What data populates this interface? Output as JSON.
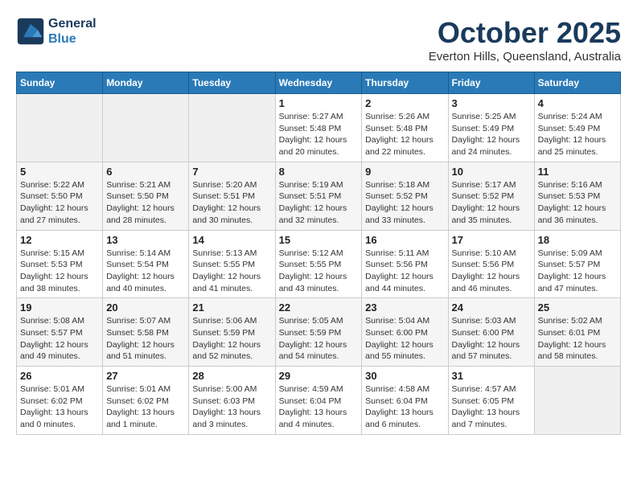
{
  "header": {
    "logo_line1": "General",
    "logo_line2": "Blue",
    "month": "October 2025",
    "location": "Everton Hills, Queensland, Australia"
  },
  "days_of_week": [
    "Sunday",
    "Monday",
    "Tuesday",
    "Wednesday",
    "Thursday",
    "Friday",
    "Saturday"
  ],
  "weeks": [
    [
      {
        "day": "",
        "info": ""
      },
      {
        "day": "",
        "info": ""
      },
      {
        "day": "",
        "info": ""
      },
      {
        "day": "1",
        "info": "Sunrise: 5:27 AM\nSunset: 5:48 PM\nDaylight: 12 hours\nand 20 minutes."
      },
      {
        "day": "2",
        "info": "Sunrise: 5:26 AM\nSunset: 5:48 PM\nDaylight: 12 hours\nand 22 minutes."
      },
      {
        "day": "3",
        "info": "Sunrise: 5:25 AM\nSunset: 5:49 PM\nDaylight: 12 hours\nand 24 minutes."
      },
      {
        "day": "4",
        "info": "Sunrise: 5:24 AM\nSunset: 5:49 PM\nDaylight: 12 hours\nand 25 minutes."
      }
    ],
    [
      {
        "day": "5",
        "info": "Sunrise: 5:22 AM\nSunset: 5:50 PM\nDaylight: 12 hours\nand 27 minutes."
      },
      {
        "day": "6",
        "info": "Sunrise: 5:21 AM\nSunset: 5:50 PM\nDaylight: 12 hours\nand 28 minutes."
      },
      {
        "day": "7",
        "info": "Sunrise: 5:20 AM\nSunset: 5:51 PM\nDaylight: 12 hours\nand 30 minutes."
      },
      {
        "day": "8",
        "info": "Sunrise: 5:19 AM\nSunset: 5:51 PM\nDaylight: 12 hours\nand 32 minutes."
      },
      {
        "day": "9",
        "info": "Sunrise: 5:18 AM\nSunset: 5:52 PM\nDaylight: 12 hours\nand 33 minutes."
      },
      {
        "day": "10",
        "info": "Sunrise: 5:17 AM\nSunset: 5:52 PM\nDaylight: 12 hours\nand 35 minutes."
      },
      {
        "day": "11",
        "info": "Sunrise: 5:16 AM\nSunset: 5:53 PM\nDaylight: 12 hours\nand 36 minutes."
      }
    ],
    [
      {
        "day": "12",
        "info": "Sunrise: 5:15 AM\nSunset: 5:53 PM\nDaylight: 12 hours\nand 38 minutes."
      },
      {
        "day": "13",
        "info": "Sunrise: 5:14 AM\nSunset: 5:54 PM\nDaylight: 12 hours\nand 40 minutes."
      },
      {
        "day": "14",
        "info": "Sunrise: 5:13 AM\nSunset: 5:55 PM\nDaylight: 12 hours\nand 41 minutes."
      },
      {
        "day": "15",
        "info": "Sunrise: 5:12 AM\nSunset: 5:55 PM\nDaylight: 12 hours\nand 43 minutes."
      },
      {
        "day": "16",
        "info": "Sunrise: 5:11 AM\nSunset: 5:56 PM\nDaylight: 12 hours\nand 44 minutes."
      },
      {
        "day": "17",
        "info": "Sunrise: 5:10 AM\nSunset: 5:56 PM\nDaylight: 12 hours\nand 46 minutes."
      },
      {
        "day": "18",
        "info": "Sunrise: 5:09 AM\nSunset: 5:57 PM\nDaylight: 12 hours\nand 47 minutes."
      }
    ],
    [
      {
        "day": "19",
        "info": "Sunrise: 5:08 AM\nSunset: 5:57 PM\nDaylight: 12 hours\nand 49 minutes."
      },
      {
        "day": "20",
        "info": "Sunrise: 5:07 AM\nSunset: 5:58 PM\nDaylight: 12 hours\nand 51 minutes."
      },
      {
        "day": "21",
        "info": "Sunrise: 5:06 AM\nSunset: 5:59 PM\nDaylight: 12 hours\nand 52 minutes."
      },
      {
        "day": "22",
        "info": "Sunrise: 5:05 AM\nSunset: 5:59 PM\nDaylight: 12 hours\nand 54 minutes."
      },
      {
        "day": "23",
        "info": "Sunrise: 5:04 AM\nSunset: 6:00 PM\nDaylight: 12 hours\nand 55 minutes."
      },
      {
        "day": "24",
        "info": "Sunrise: 5:03 AM\nSunset: 6:00 PM\nDaylight: 12 hours\nand 57 minutes."
      },
      {
        "day": "25",
        "info": "Sunrise: 5:02 AM\nSunset: 6:01 PM\nDaylight: 12 hours\nand 58 minutes."
      }
    ],
    [
      {
        "day": "26",
        "info": "Sunrise: 5:01 AM\nSunset: 6:02 PM\nDaylight: 13 hours\nand 0 minutes."
      },
      {
        "day": "27",
        "info": "Sunrise: 5:01 AM\nSunset: 6:02 PM\nDaylight: 13 hours\nand 1 minute."
      },
      {
        "day": "28",
        "info": "Sunrise: 5:00 AM\nSunset: 6:03 PM\nDaylight: 13 hours\nand 3 minutes."
      },
      {
        "day": "29",
        "info": "Sunrise: 4:59 AM\nSunset: 6:04 PM\nDaylight: 13 hours\nand 4 minutes."
      },
      {
        "day": "30",
        "info": "Sunrise: 4:58 AM\nSunset: 6:04 PM\nDaylight: 13 hours\nand 6 minutes."
      },
      {
        "day": "31",
        "info": "Sunrise: 4:57 AM\nSunset: 6:05 PM\nDaylight: 13 hours\nand 7 minutes."
      },
      {
        "day": "",
        "info": ""
      }
    ]
  ]
}
